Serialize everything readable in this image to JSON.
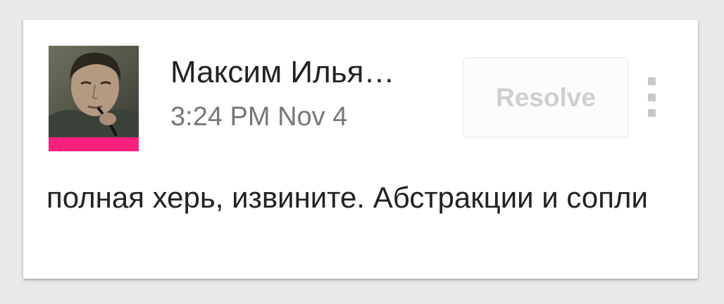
{
  "comment": {
    "author": "Максим Илья…",
    "timestamp": "3:24 PM Nov 4",
    "resolve_label": "Resolve",
    "body": "полная херь, извините. Абстракции и сопли",
    "avatar_accent_color": "#ff1f7d",
    "menu_icon": "more-vertical-icon"
  }
}
